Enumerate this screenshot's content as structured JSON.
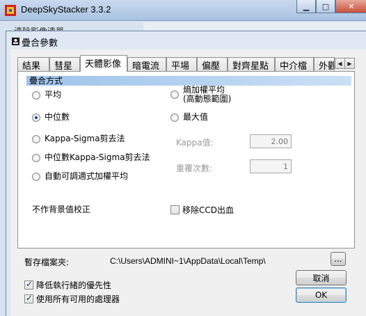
{
  "app": {
    "title": "DeepSkyStacker 3.3.2",
    "behind_tab": "清除影像清單",
    "window_buttons": {
      "minimize": "▁",
      "maximize": "□",
      "close": "✕"
    }
  },
  "dialog": {
    "title": "疊合參數",
    "tabs": [
      "結果",
      "彗星",
      "天體影像",
      "暗電流",
      "平場",
      "偏壓",
      "對齊星點",
      "中介檔",
      "外觀"
    ],
    "active_tab": "天體影像",
    "tab_scroll": {
      "left": "◀",
      "right": "▶"
    },
    "section_title": "疊合方式",
    "methods": {
      "average": "平均",
      "median": "中位數",
      "kappa_sigma": "Kappa-Sigma剪去法",
      "median_kappa_sigma": "中位數Kappa-Sigma剪去法",
      "auto_adaptive": "自動可調適式加權平均",
      "entropy_line1": "熵加權平均",
      "entropy_line2": "(高動態範圍)",
      "maximum": "最大值",
      "selected": "median"
    },
    "kappa_label": "Kappa值:",
    "kappa_value": "2.00",
    "iterations_label": "重覆次數:",
    "iterations_value": "1",
    "no_bg_calibration": "不作背景值校正",
    "remove_ccd_bloom": "移除CCD出血",
    "temp_folder_label": "暫存檔案夾:",
    "temp_folder_path": "C:\\Users\\ADMINI~1\\AppData\\Local\\Temp\\",
    "browse_label": "...",
    "reduce_priority": "降低執行緒的優先性",
    "use_all_processors": "使用所有可用的處理器",
    "cancel_label": "取消",
    "ok_label": "OK"
  }
}
